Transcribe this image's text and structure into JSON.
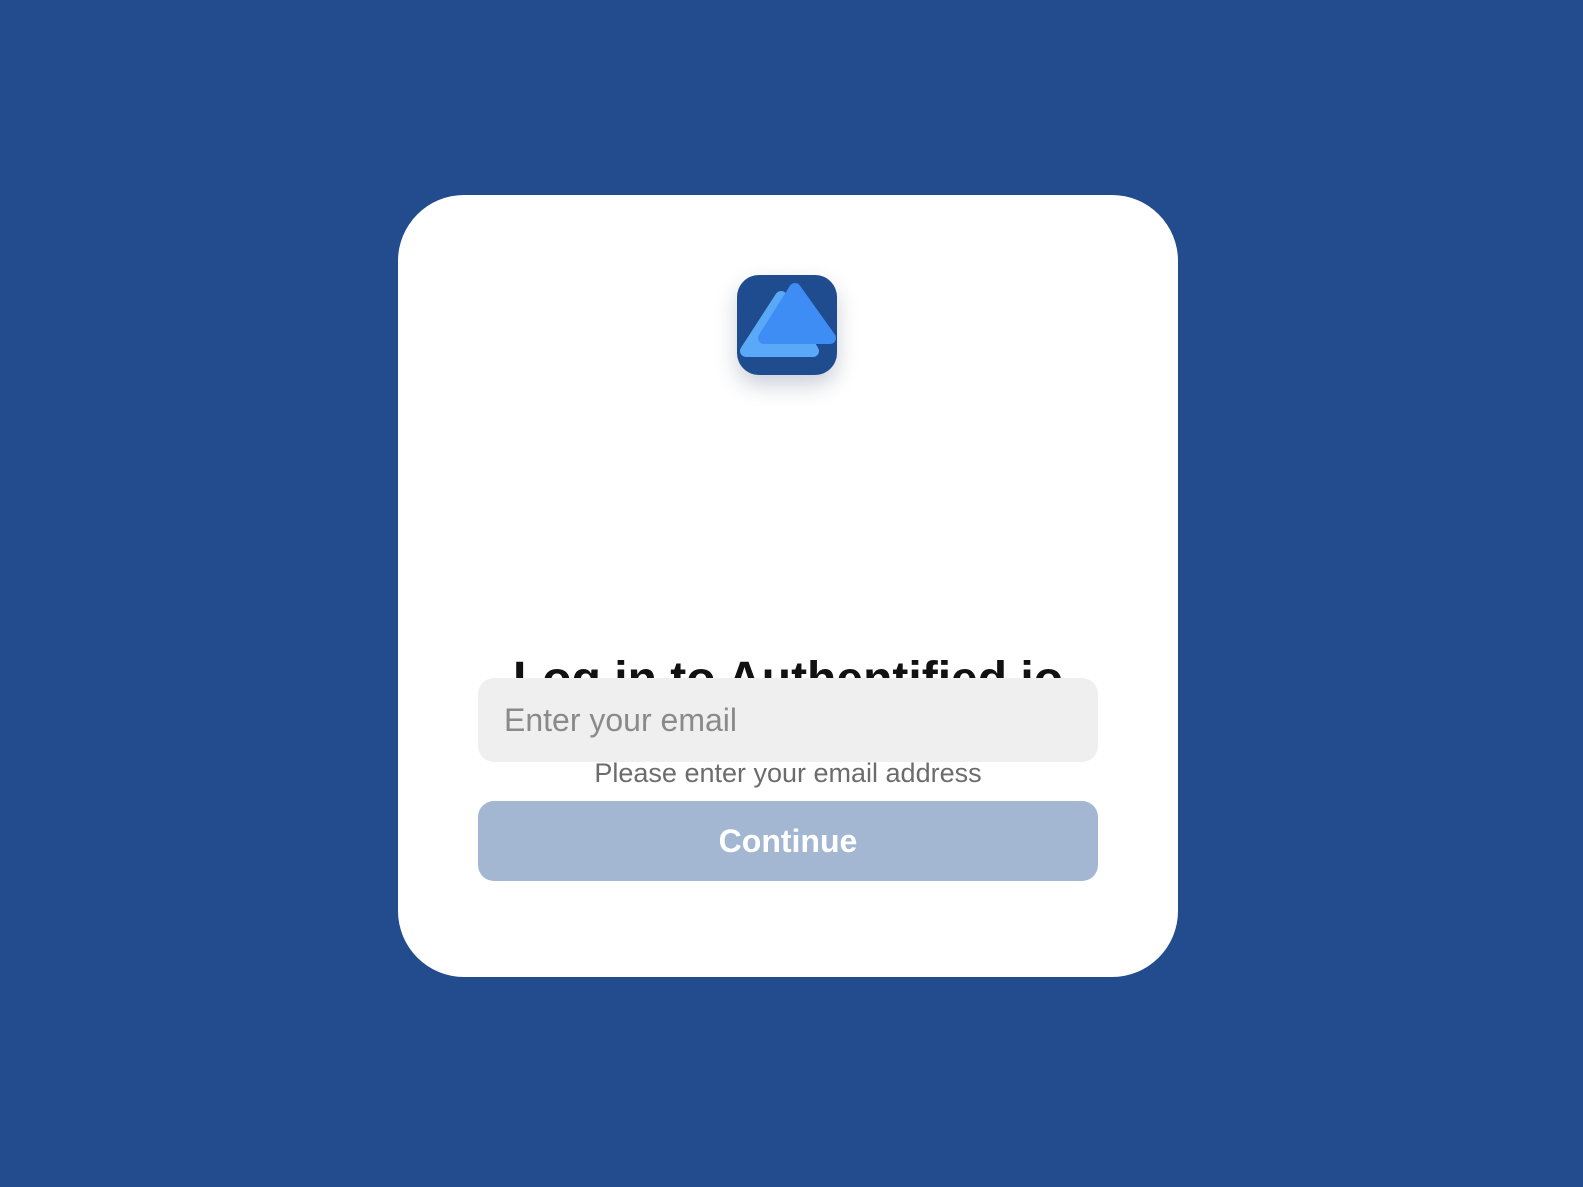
{
  "colors": {
    "background": "#224c8d",
    "card": "#ffffff",
    "logo_background": "#1f4b8f",
    "logo_back_triangle": "#5aa8f8",
    "logo_front_triangle": "#3d8df5",
    "title_text": "#111111",
    "subtitle_text": "#6c6c6c",
    "input_background": "#efefef",
    "button_background": "#a3b7d2",
    "button_text": "#ffffff"
  },
  "login": {
    "logo_icon": "stacked-triangles-logo-icon",
    "title": "Log in to Authentified.io",
    "subtitle": "Please enter your email address",
    "email_input": {
      "placeholder": "Enter your email",
      "value": ""
    },
    "continue_button": {
      "label": "Continue",
      "disabled": true
    }
  }
}
